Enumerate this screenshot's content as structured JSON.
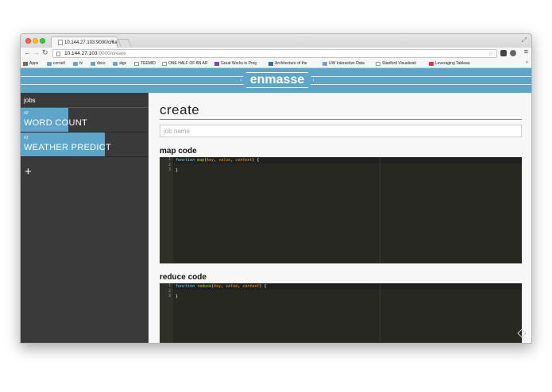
{
  "browser": {
    "tab_title": "10.144.27.103:9000/crea",
    "tab_close": "×",
    "url_host": "10.144.27.103",
    "url_path": ":9000/create",
    "bookmarks_more": "»",
    "bookmarks": [
      {
        "label": "Apps",
        "icon": "apps-icon"
      },
      {
        "label": "cornell",
        "icon": "folder-icon"
      },
      {
        "label": "tv",
        "icon": "folder-icon"
      },
      {
        "label": "docs",
        "icon": "folder-icon"
      },
      {
        "label": "algs",
        "icon": "folder-icon"
      },
      {
        "label": "TEEMID",
        "icon": "page-icon"
      },
      {
        "label": "ONE HALF OF AN AR",
        "icon": "page-icon"
      },
      {
        "label": "Great Works in Prog",
        "icon": "purple-icon"
      },
      {
        "label": "Architecture of the",
        "icon": "blue-icon"
      },
      {
        "label": "UW Interactive Data",
        "icon": "chart-icon"
      },
      {
        "label": "Stanford Visualizati",
        "icon": "page-icon"
      },
      {
        "label": "Leveraging Tableau",
        "icon": "youtube-icon"
      }
    ]
  },
  "app": {
    "logo": "enmasse",
    "sidebar": {
      "header": "jobs",
      "jobs": [
        {
          "number": "#2",
          "name": "WORD COUNT",
          "progress": 0.37
        },
        {
          "number": "#1",
          "name": "WEATHER PREDICT",
          "progress": 0.66
        }
      ],
      "add_label": "+"
    },
    "main": {
      "title": "create",
      "job_name_placeholder": "job name",
      "map_label": "map code",
      "reduce_label": "reduce code",
      "map_code": {
        "line_numbers": [
          "1",
          "2",
          "3"
        ],
        "keyword": "function",
        "fn_name": "map",
        "args": [
          "key",
          "value",
          "context"
        ],
        "close": "}"
      },
      "reduce_code": {
        "line_numbers": [
          "1",
          "2",
          "3"
        ],
        "keyword": "function",
        "fn_name": "reduce",
        "args": [
          "key",
          "value",
          "context"
        ],
        "close": "}"
      }
    }
  },
  "colors": {
    "accent": "#5ea6c9",
    "sidebar": "#3a3a3a",
    "editor_bg": "#272822"
  }
}
